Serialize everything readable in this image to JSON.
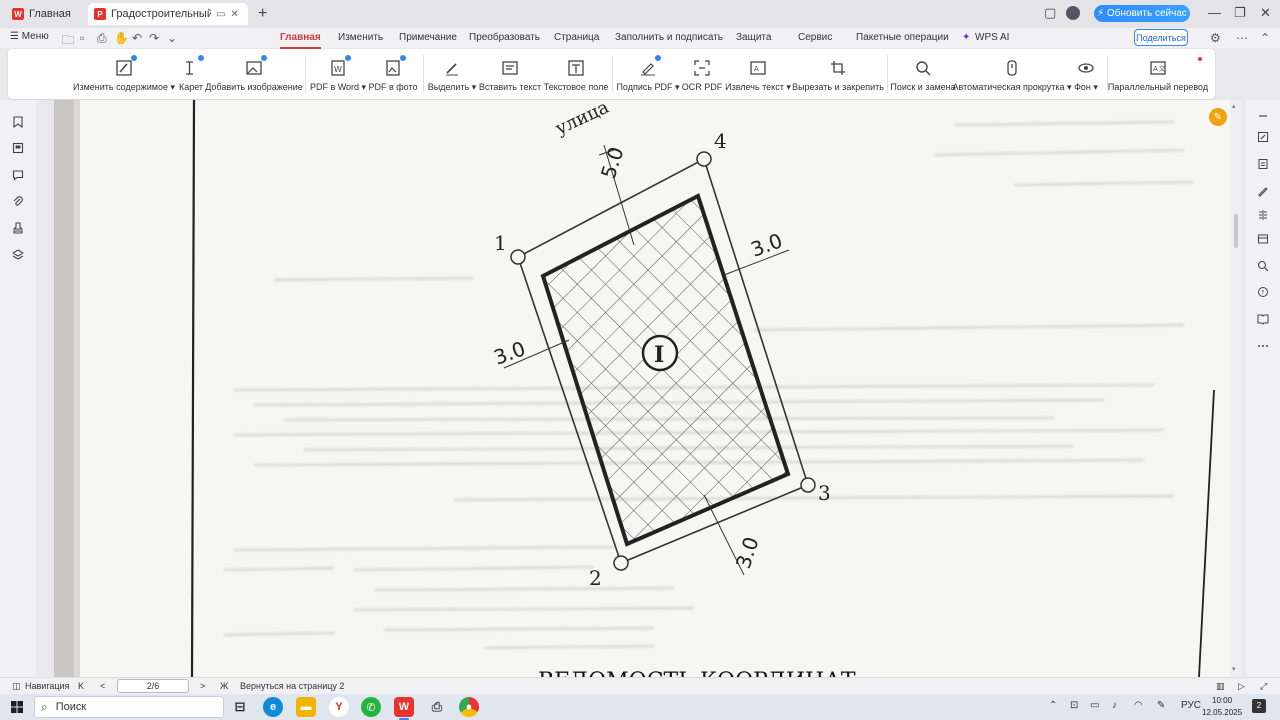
{
  "tabs": {
    "home_label": "Главная",
    "doc_label": "Градостроительный план.p",
    "add": "+"
  },
  "topright": {
    "upgrade": "⚡ Обновить сейчас",
    "minimize": "—",
    "restore": "❐",
    "close": "✕"
  },
  "menubar": {
    "menu_label": "☰ Меню",
    "tabs": [
      "Главная",
      "Изменить",
      "Примечание",
      "Преобразовать",
      "Страница",
      "Заполнить и подписать",
      "Защита",
      "Сервис",
      "Пакетные операции",
      "WPS AI"
    ],
    "share": "Поделиться"
  },
  "ribbon": {
    "buttons": [
      {
        "label": "Изменить содержимое ▾",
        "icon": "edit-content-icon"
      },
      {
        "label": "Карет",
        "icon": "cursor-icon"
      },
      {
        "label": "Добавить изображение",
        "icon": "add-image-icon"
      },
      {
        "label": "PDF в Word ▾",
        "icon": "pdf-to-word-icon"
      },
      {
        "label": "PDF в фото",
        "icon": "pdf-to-image-icon"
      },
      {
        "label": "Выделить ▾",
        "icon": "highlight-icon"
      },
      {
        "label": "Вставить текст",
        "icon": "insert-text-icon"
      },
      {
        "label": "Текстовое поле",
        "icon": "text-box-icon"
      },
      {
        "label": "Подпись PDF ▾",
        "icon": "signature-icon"
      },
      {
        "label": "OCR PDF",
        "icon": "ocr-icon"
      },
      {
        "label": "Извлечь текст ▾",
        "icon": "extract-text-icon"
      },
      {
        "label": "Вырезать и закрепить",
        "icon": "crop-pin-icon"
      },
      {
        "label": "Поиск и замена",
        "icon": "search-replace-icon"
      },
      {
        "label": "Автоматическая прокрутка ▾",
        "icon": "auto-scroll-icon"
      },
      {
        "label": "Фон ▾",
        "icon": "background-icon"
      },
      {
        "label": "Параллельный перевод",
        "icon": "translate-icon"
      }
    ]
  },
  "drawing": {
    "street": "улица",
    "p1": "1",
    "p2": "2",
    "p3": "3",
    "p4": "4",
    "d_top": "5.0",
    "d_right": "3.0",
    "d_left": "3.0",
    "d_bottom": "3.0",
    "zone": "I",
    "footer_heading": "ВЕДОМОСТЬ КООРДИНАТ"
  },
  "statusbar": {
    "nav": "Навигация",
    "first": "K",
    "prev": "<",
    "page": "2/6",
    "next": ">",
    "last": "Ж",
    "back": "Вернуться на страницу 2"
  },
  "taskbar": {
    "search": "Поиск",
    "lang": "РУС",
    "time": "10:00",
    "date": "12.05.2025",
    "notif": "2"
  }
}
